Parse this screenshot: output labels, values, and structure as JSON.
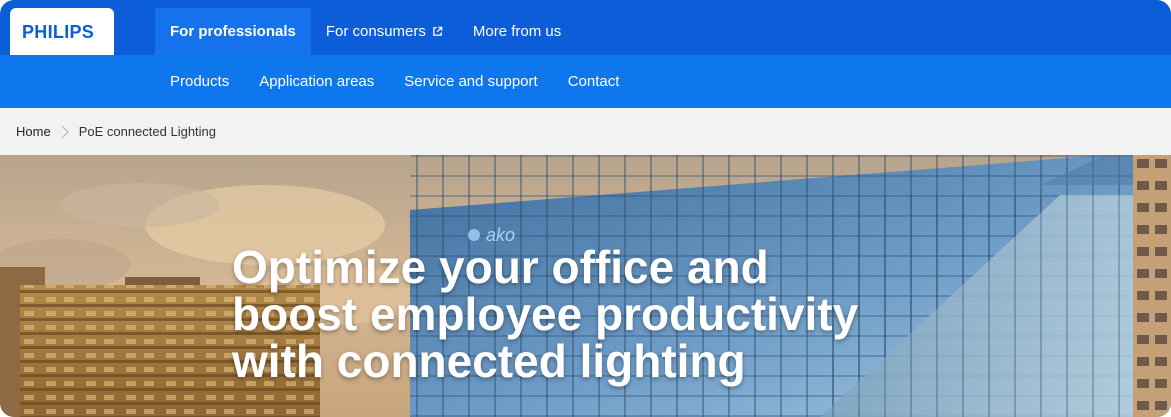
{
  "brand": {
    "logo": "PHILIPS"
  },
  "top_nav": [
    {
      "label": "For professionals",
      "active": true,
      "external": false
    },
    {
      "label": "For consumers",
      "active": false,
      "external": true
    },
    {
      "label": "More from us",
      "active": false,
      "external": false
    }
  ],
  "secondary_nav": [
    {
      "label": "Products"
    },
    {
      "label": "Application areas"
    },
    {
      "label": "Service and support"
    },
    {
      "label": "Contact"
    }
  ],
  "breadcrumb": {
    "home": "Home",
    "current": "PoE connected Lighting",
    "separator_icon": "chevron-right-icon"
  },
  "hero": {
    "lines": [
      "Optimize your office and",
      "boost employee productivity",
      "with connected lighting"
    ],
    "building_sign": "ako"
  },
  "colors": {
    "brand_blue": "#0b5ed7",
    "secondary_blue": "#0f77ee",
    "active_tab": "#1672ec",
    "breadcrumb_bg": "#f2f2f2"
  }
}
